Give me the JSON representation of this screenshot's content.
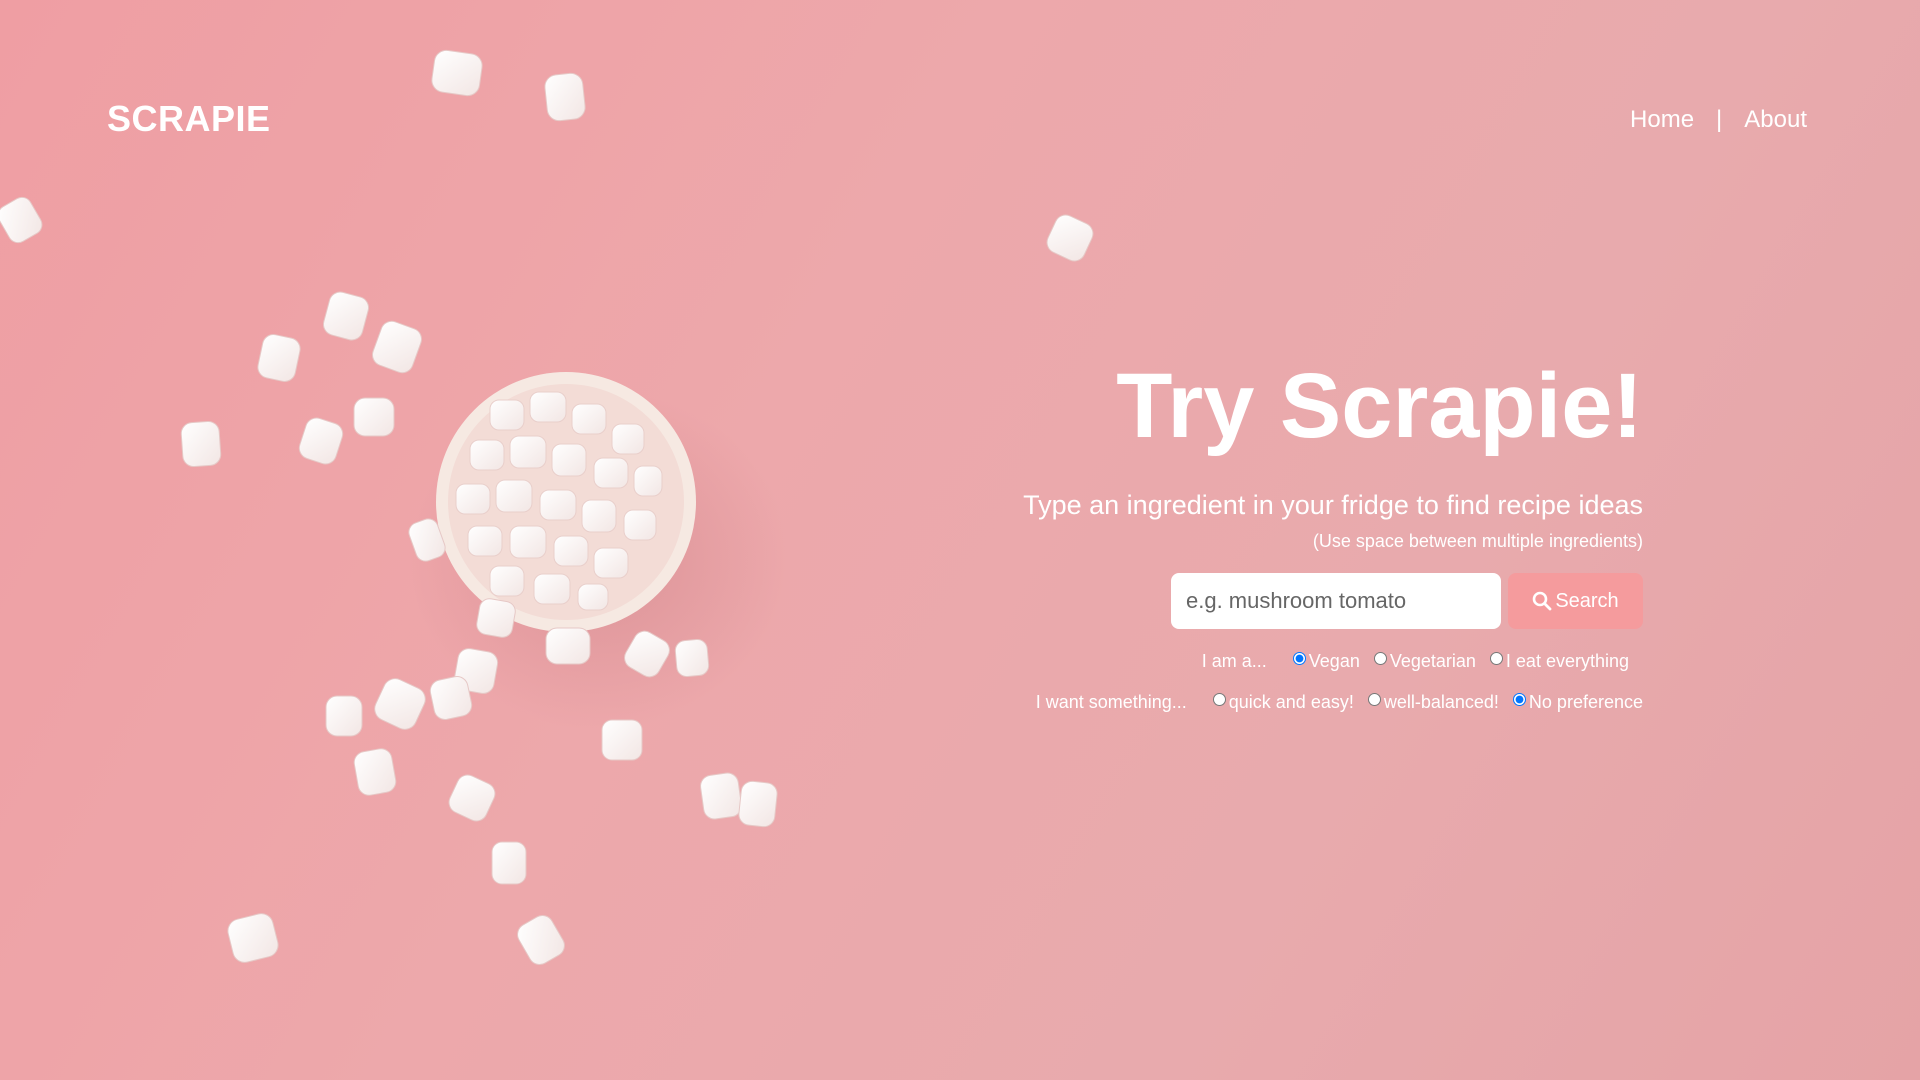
{
  "brand": {
    "logo": "SCRAPIE"
  },
  "nav": {
    "home": "Home",
    "separator": "|",
    "about": "About"
  },
  "hero": {
    "title": "Try Scrapie!",
    "subtitle": "Type an ingredient in your fridge to find recipe ideas",
    "hint": "(Use space between multiple ingredients)"
  },
  "search": {
    "placeholder": "e.g. mushroom tomato",
    "value": "",
    "button_label": "Search",
    "button_icon": "search-icon"
  },
  "diet": {
    "lead": "I am a...",
    "options": [
      "Vegan",
      "Vegetarian",
      "I eat everything"
    ],
    "selected": "Vegan"
  },
  "preference": {
    "lead": "I want something...",
    "options": [
      "quick and easy!",
      "well-balanced!",
      "No preference"
    ],
    "selected": "No preference"
  },
  "colors": {
    "background": "#eba5a8",
    "button": "#f59b9d",
    "text": "#ffffff"
  }
}
